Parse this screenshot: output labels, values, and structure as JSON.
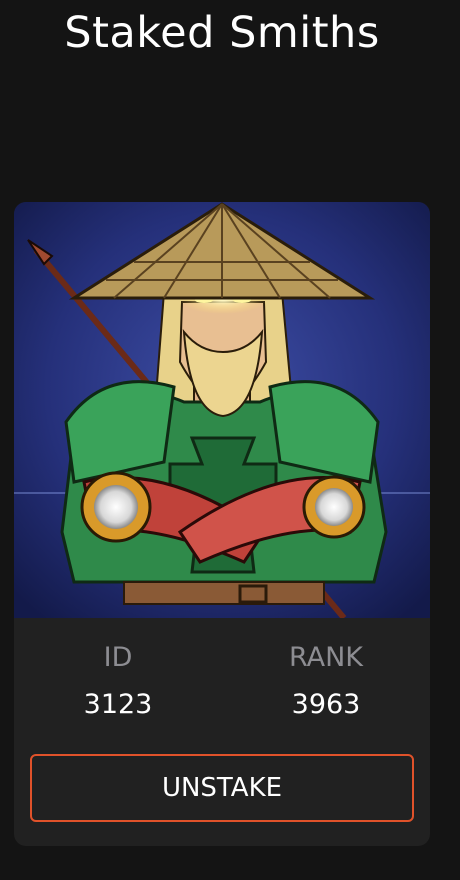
{
  "page": {
    "title": "Staked Smiths"
  },
  "card": {
    "image_alt": "Smith NFT artwork: bearded warrior with straw hat and green armor holding a spear",
    "stats": [
      {
        "label": "ID",
        "value": "3123"
      },
      {
        "label": "RANK",
        "value": "3963"
      }
    ],
    "unstake_label": "UNSTAKE"
  },
  "colors": {
    "background": "#141414",
    "card": "#212121",
    "accent": "#e0522a",
    "muted_label": "#8d8d92"
  },
  "icons": [
    "nft-artwork"
  ]
}
